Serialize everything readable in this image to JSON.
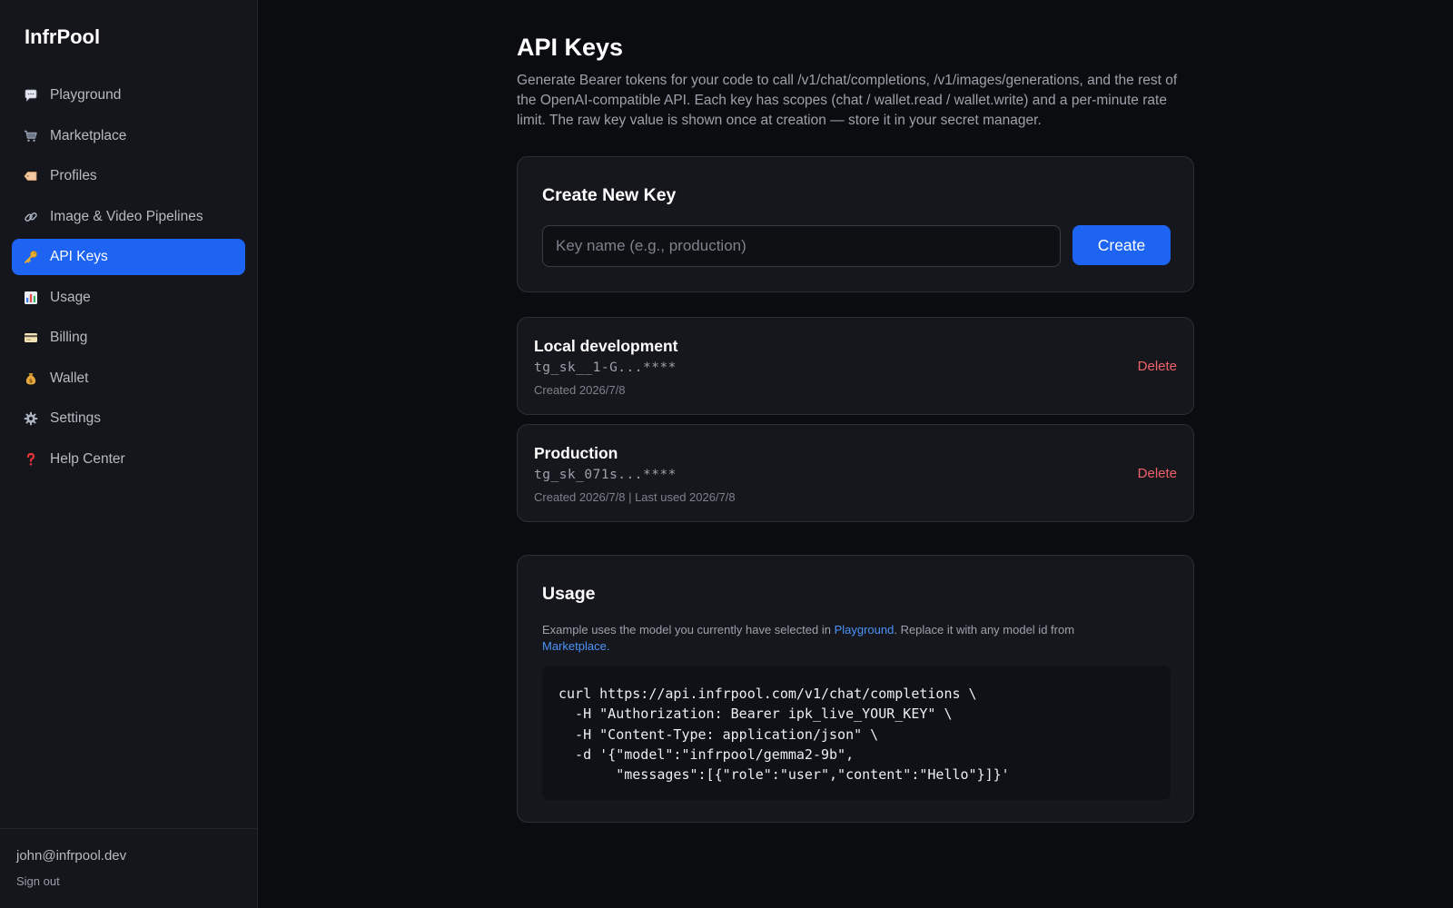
{
  "app": {
    "name": "InfrPool"
  },
  "sidebar": {
    "items": [
      {
        "label": "Playground",
        "icon": "speech-bubble-icon",
        "active": false
      },
      {
        "label": "Marketplace",
        "icon": "shopping-cart-icon",
        "active": false
      },
      {
        "label": "Profiles",
        "icon": "label-tag-icon",
        "active": false
      },
      {
        "label": "Image & Video Pipelines",
        "icon": "link-chain-icon",
        "active": false
      },
      {
        "label": "API Keys",
        "icon": "key-icon",
        "active": true
      },
      {
        "label": "Usage",
        "icon": "bar-chart-icon",
        "active": false
      },
      {
        "label": "Billing",
        "icon": "credit-card-icon",
        "active": false
      },
      {
        "label": "Wallet",
        "icon": "money-bag-icon",
        "active": false
      },
      {
        "label": "Settings",
        "icon": "gear-icon",
        "active": false
      },
      {
        "label": "Help Center",
        "icon": "question-mark-icon",
        "active": false
      }
    ],
    "footer": {
      "email": "john@infrpool.dev",
      "sign_out": "Sign out"
    }
  },
  "page": {
    "title": "API Keys",
    "description": "Generate Bearer tokens for your code to call /v1/chat/completions, /v1/images/generations, and the rest of the OpenAI-compatible API. Each key has scopes (chat / wallet.read / wallet.write) and a per-minute rate limit. The raw key value is shown once at creation — store it in your secret manager."
  },
  "create": {
    "title": "Create New Key",
    "placeholder": "Key name (e.g., production)",
    "value": "",
    "button": "Create"
  },
  "keys": [
    {
      "name": "Local development",
      "value": "tg_sk__1-G...****",
      "meta": "Created 2026/7/8",
      "delete_label": "Delete"
    },
    {
      "name": "Production",
      "value": "tg_sk_071s...****",
      "meta": "Created 2026/7/8 | Last used 2026/7/8",
      "delete_label": "Delete"
    }
  ],
  "usage": {
    "title": "Usage",
    "note_prefix": "Example uses the model you currently have selected in ",
    "note_link1": "Playground",
    "note_middle": ". Replace it with any model id from ",
    "note_link2": "Marketplace",
    "note_suffix": ".",
    "code": "curl https://api.infrpool.com/v1/chat/completions \\\n  -H \"Authorization: Bearer ipk_live_YOUR_KEY\" \\\n  -H \"Content-Type: application/json\" \\\n  -d '{\"model\":\"infrpool/gemma2-9b\",\n       \"messages\":[{\"role\":\"user\",\"content\":\"Hello\"}]}'"
  },
  "colors": {
    "accent": "#1d64f2",
    "background": "#0b0c10",
    "sidebar": "#15161b",
    "card": "#16171d",
    "danger": "#f0626a",
    "link": "#4b93f6"
  }
}
